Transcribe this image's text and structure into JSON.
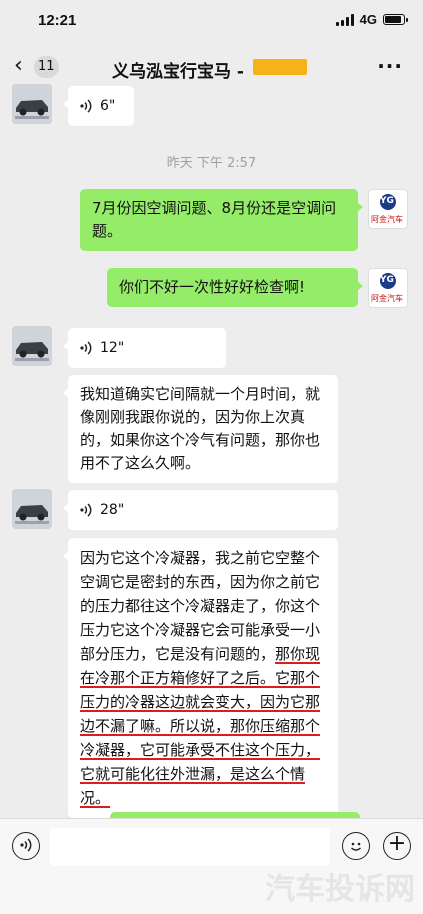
{
  "status": {
    "time": "12:21",
    "network": "4G"
  },
  "nav": {
    "back_count": "11",
    "title": "义乌泓宝行宝马 -",
    "more": "···"
  },
  "messages": {
    "voice1": "6\"",
    "timestamp": "昨天 下午 2:57",
    "sent1": "7月份因空调问题、8月份还是空调问题。",
    "sent2": "你们不好一次性好好检查啊!",
    "voice2": "12\"",
    "recv1": "我知道确实它间隔就一个月时间，就像刚刚我跟你说的，因为你上次真的，如果你这个冷气有问题，那你也用不了这么久啊。",
    "voice3": "28\"",
    "recv2_part1": "因为它这个冷凝器，我之前它空整个空调它是密封的东西，因为你之前它的压力都往这个冷凝器走了，你这个压力它这个冷凝器它会可能承受一小部分压力，它是没有问题的，",
    "recv2_part2": "那你现在冷那个正方箱修好了之后。它那个压力的冷器这边就会变大，因为它那边不漏了嘛。所以说，那你压缩那个冷凝器，它可能承受不住这个压力，它就可能化往外泄漏，是这么个情况。"
  },
  "avatar_right_logo": "YG",
  "avatar_right_caption": "阿金汽车",
  "watermark": "汽车投诉网",
  "colors": {
    "sent_bubble": "#95ec69",
    "underline": "#d81e1e",
    "redaction": "#f7b21a"
  }
}
